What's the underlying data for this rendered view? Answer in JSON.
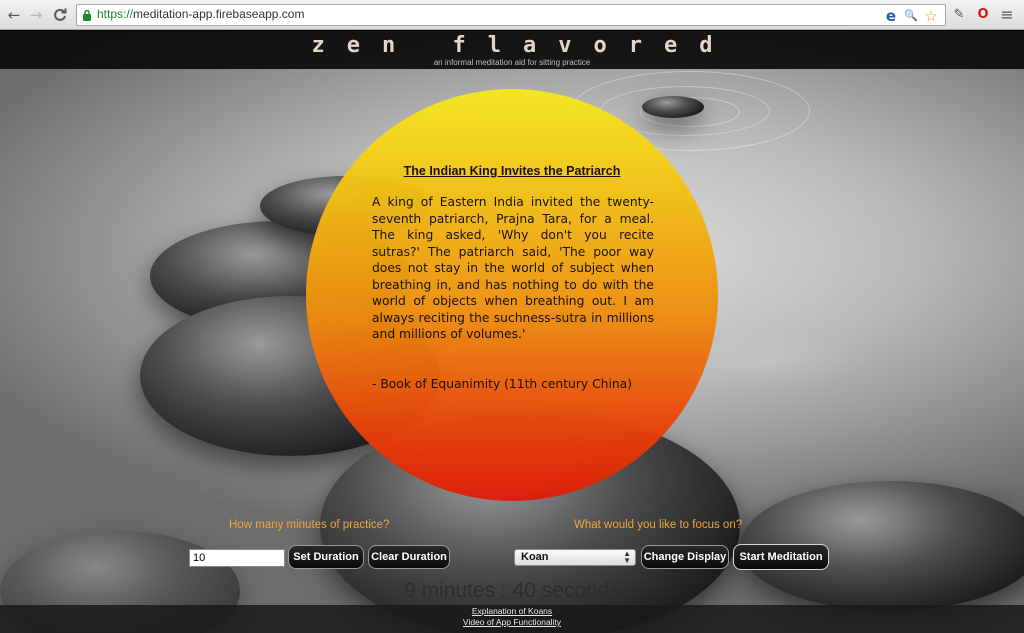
{
  "browser": {
    "url_scheme": "https://",
    "url_host": "meditation-app.firebaseapp.com",
    "nav": {
      "back": "←",
      "forward": "→",
      "reload": "C"
    },
    "omnibox_icons": [
      "e",
      "🔍",
      "☆"
    ],
    "extension_icons": [
      "✎",
      "O",
      "≡"
    ]
  },
  "site": {
    "title": "zen flavored",
    "tagline": "an informal meditation aid for sitting practice"
  },
  "koan": {
    "title": "The Indian King Invites the Patriarch",
    "body": "A king of Eastern India invited the twenty-seventh patriarch, Prajna Tara, for a meal. The king asked, 'Why don't you recite sutras?' The patriarch said, 'The poor way does not stay in the world of subject when breathing in, and has nothing to do with the world of objects when breathing out. I am always reciting the suchness-sutra in millions and millions of volumes.'",
    "source": "- Book of Equanimity (11th century China)"
  },
  "controls": {
    "minutes_label": "How many minutes of practice?",
    "focus_label": "What would you like to focus on?",
    "duration_value": "10",
    "set_duration": "Set Duration",
    "clear_duration": "Clear Duration",
    "focus_selected": "Koan",
    "change_display": "Change Display",
    "start_meditation": "Start Meditation"
  },
  "timer": "9 minutes : 40 seconds",
  "footer": {
    "link_koans": "Explanation of Koans",
    "link_video": "Video of App Functionality"
  },
  "colors": {
    "accent_label": "#f0a53a",
    "sun_top": "#f5e81e",
    "sun_bottom": "#e01c06"
  }
}
